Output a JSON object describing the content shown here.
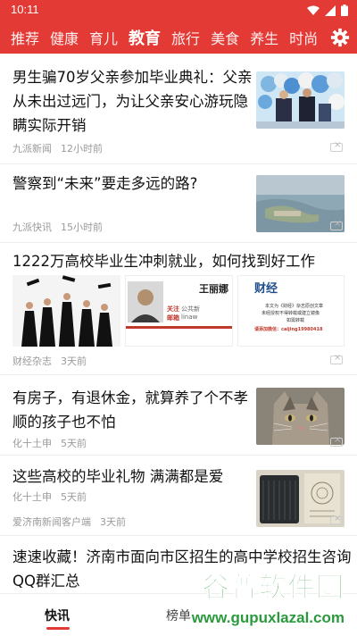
{
  "status": {
    "time": "10:11"
  },
  "channels": [
    {
      "label": "推荐"
    },
    {
      "label": "健康"
    },
    {
      "label": "育儿"
    },
    {
      "label": "教育",
      "active": true
    },
    {
      "label": "旅行"
    },
    {
      "label": "美食"
    },
    {
      "label": "养生"
    },
    {
      "label": "时尚"
    }
  ],
  "feed": [
    {
      "title_line1": "男生骗70岁父亲参加毕业典礼：父亲",
      "title_line2": "从未出过远门，为让父亲安心游玩隐",
      "title_line3": "瞒实际开销",
      "source": "九派新闻",
      "time": "12小时前"
    },
    {
      "title_line1": "警察到“未来”要走多远的路?",
      "source": "九派快讯",
      "time": "15小时前"
    },
    {
      "title_line1": "1222万高校毕业生冲刺就业，如何找到好工作",
      "source": "财经杂志",
      "time": "3天前",
      "card_name": "王丽娜",
      "card_line1": "关注",
      "card_line2": "邮箱",
      "card_sub1": "公共新",
      "card_sub2": "linaw",
      "poster_brand": "财经",
      "poster_line1": "本文为《财经》杂志原创文章",
      "poster_line2": "未经授权不得转载或建立镜像",
      "poster_line3": "如需转载",
      "poster_line4": "请添加微信：caijing19980418"
    },
    {
      "title_line1": "有房子，有退休金，就算养了个不孝",
      "title_line2": "顺的孩子也不怕",
      "source": "化十土申",
      "time": "5天前"
    },
    {
      "title_line1": "这些高校的毕业礼物 满满都是爱",
      "source": "爱济南新闻客户端",
      "time": "3天前"
    },
    {
      "title_line1": "速速收藏！济南市面向市区招生的高中学校招生咨询",
      "title_line2": "QQ群汇总"
    }
  ],
  "tabbar": {
    "tab1": "快讯",
    "tab2": "榜单"
  },
  "watermark": {
    "title": "谷普软件园",
    "url": "www.gupuxlazal.com"
  },
  "colors": {
    "brand_red": "#e43a35",
    "watermark_green": "#2b9a3d"
  }
}
